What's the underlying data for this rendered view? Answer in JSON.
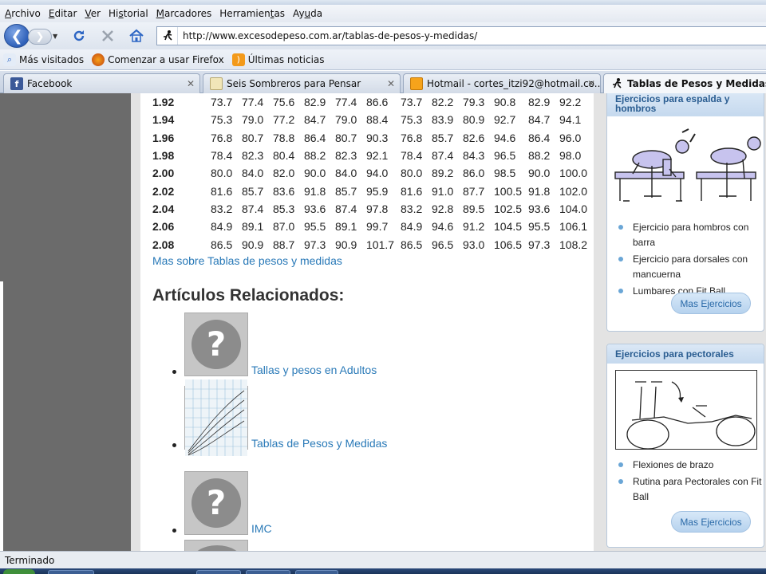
{
  "menubar": {
    "items": [
      {
        "pre": "",
        "ul": "A",
        "post": "rchivo"
      },
      {
        "pre": "",
        "ul": "E",
        "post": "ditar"
      },
      {
        "pre": "",
        "ul": "V",
        "post": "er"
      },
      {
        "pre": "Hi",
        "ul": "s",
        "post": "torial"
      },
      {
        "pre": "",
        "ul": "M",
        "post": "arcadores"
      },
      {
        "pre": "Herramien",
        "ul": "t",
        "post": "as"
      },
      {
        "pre": "Ay",
        "ul": "u",
        "post": "da"
      }
    ]
  },
  "navbar": {
    "back_glyph": "❮",
    "forward_glyph": "❯",
    "url": "http://www.excesodepeso.com.ar/tablas-de-pesos-y-medidas/"
  },
  "bookmarks": {
    "items": [
      "Más visitados",
      "Comenzar a usar Firefox",
      "Últimas noticias"
    ]
  },
  "tabs": [
    {
      "label": "Facebook",
      "icon": "facebook-icon",
      "active": false
    },
    {
      "label": "Seis Sombreros para Pensar",
      "icon": "page-icon",
      "active": false
    },
    {
      "label": "Hotmail - cortes_itzi92@hotmail.co...",
      "icon": "mail-icon",
      "active": false
    },
    {
      "label": "Tablas de Pesos y Medidas | Exce",
      "icon": "runner-icon",
      "active": true
    }
  ],
  "weights_table": {
    "rows": [
      {
        "height": "1.92",
        "values": [
          "73.7",
          "77.4",
          "75.6",
          "82.9",
          "77.4",
          "86.6",
          "73.7",
          "82.2",
          "79.3",
          "90.8",
          "82.9",
          "92.2"
        ]
      },
      {
        "height": "1.94",
        "values": [
          "75.3",
          "79.0",
          "77.2",
          "84.7",
          "79.0",
          "88.4",
          "75.3",
          "83.9",
          "80.9",
          "92.7",
          "84.7",
          "94.1"
        ]
      },
      {
        "height": "1.96",
        "values": [
          "76.8",
          "80.7",
          "78.8",
          "86.4",
          "80.7",
          "90.3",
          "76.8",
          "85.7",
          "82.6",
          "94.6",
          "86.4",
          "96.0"
        ]
      },
      {
        "height": "1.98",
        "values": [
          "78.4",
          "82.3",
          "80.4",
          "88.2",
          "82.3",
          "92.1",
          "78.4",
          "87.4",
          "84.3",
          "96.5",
          "88.2",
          "98.0"
        ]
      },
      {
        "height": "2.00",
        "values": [
          "80.0",
          "84.0",
          "82.0",
          "90.0",
          "84.0",
          "94.0",
          "80.0",
          "89.2",
          "86.0",
          "98.5",
          "90.0",
          "100.0"
        ]
      },
      {
        "height": "2.02",
        "values": [
          "81.6",
          "85.7",
          "83.6",
          "91.8",
          "85.7",
          "95.9",
          "81.6",
          "91.0",
          "87.7",
          "100.5",
          "91.8",
          "102.0"
        ]
      },
      {
        "height": "2.04",
        "values": [
          "83.2",
          "87.4",
          "85.3",
          "93.6",
          "87.4",
          "97.8",
          "83.2",
          "92.8",
          "89.5",
          "102.5",
          "93.6",
          "104.0"
        ]
      },
      {
        "height": "2.06",
        "values": [
          "84.9",
          "89.1",
          "87.0",
          "95.5",
          "89.1",
          "99.7",
          "84.9",
          "94.6",
          "91.2",
          "104.5",
          "95.5",
          "106.1"
        ]
      },
      {
        "height": "2.08",
        "values": [
          "86.5",
          "90.9",
          "88.7",
          "97.3",
          "90.9",
          "101.7",
          "86.5",
          "96.5",
          "93.0",
          "106.5",
          "97.3",
          "108.2"
        ]
      }
    ]
  },
  "content": {
    "more_link": "Mas sobre Tablas de pesos y medidas",
    "related_heading": "Artículos Relacionados:",
    "related": [
      {
        "label": "Tallas y pesos en Adultos",
        "thumb": "question"
      },
      {
        "label": "Tablas de Pesos y Medidas",
        "thumb": "chart"
      },
      {
        "label": "IMC",
        "thumb": "question"
      }
    ]
  },
  "sidebar": {
    "box1": {
      "title": "Ejercicios para espalda y hombros",
      "items": [
        "Ejercicio para hombros con barra",
        "Ejercicio para dorsales con mancuerna",
        "Lumbares con Fit Ball"
      ],
      "button": "Mas Ejercicios"
    },
    "box2": {
      "title": "Ejercicios para pectorales",
      "items": [
        "Flexiones de brazo",
        "Rutina para Pectorales con Fit Ball"
      ],
      "button": "Mas Ejercicios"
    }
  },
  "statusbar": {
    "text": "Terminado"
  },
  "colors": {
    "link": "#2a7ab8",
    "sidebar_title": "#2a5d91",
    "bullet": "#6aa6d6"
  }
}
